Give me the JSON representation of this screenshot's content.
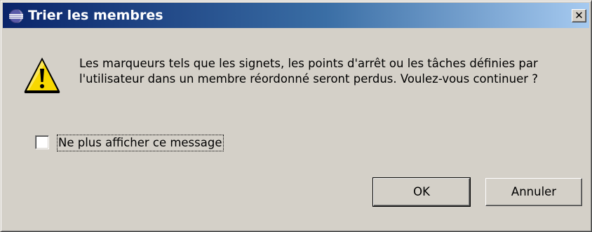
{
  "window": {
    "title": "Trier les membres",
    "app_icon": "eclipse-icon",
    "close_glyph": "✕"
  },
  "message": {
    "icon": "warning-icon",
    "text": "Les marqueurs tels que les signets, les points d'arrêt ou les tâches définies par l'utilisateur dans un membre réordonné seront perdus. Voulez-vous continuer ?"
  },
  "checkbox": {
    "label": "Ne plus afficher ce message",
    "checked": false
  },
  "buttons": {
    "ok_label": "OK",
    "cancel_label": "Annuler"
  },
  "colors": {
    "dialog_face": "#d4d0c8",
    "title_gradient_start": "#0a246a",
    "title_gradient_end": "#a6caf0",
    "warning_yellow": "#f8d800"
  }
}
